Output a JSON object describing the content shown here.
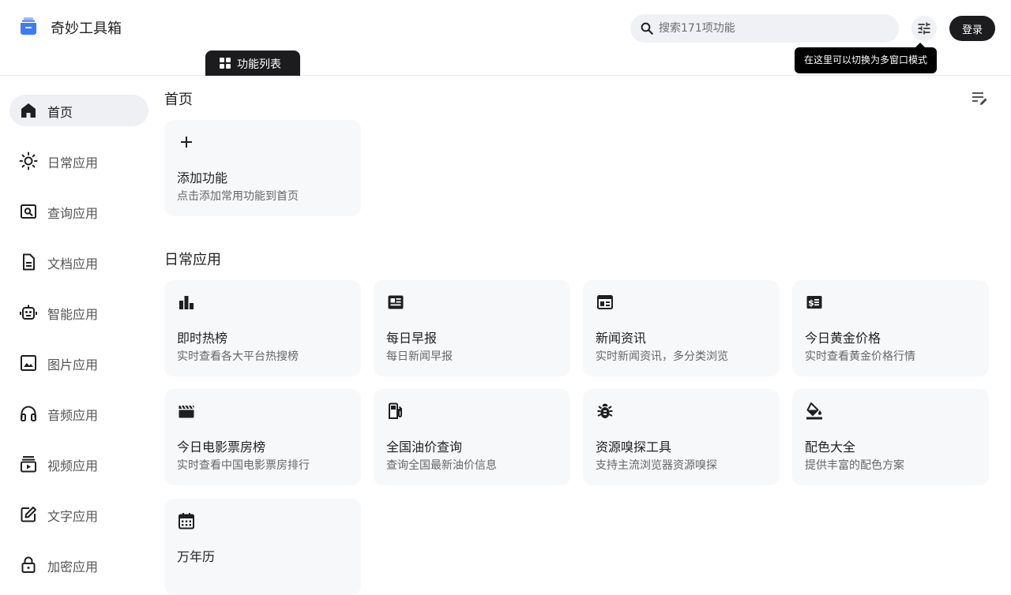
{
  "app": {
    "title": "奇妙工具箱"
  },
  "search": {
    "placeholder": "搜索171项功能"
  },
  "header": {
    "login_label": "登录",
    "tooltip": "在这里可以切换为多窗口模式",
    "tab_label": "功能列表"
  },
  "sidebar": {
    "items": [
      {
        "label": "首页",
        "icon": "home-icon",
        "active": true
      },
      {
        "label": "日常应用",
        "icon": "sun-icon"
      },
      {
        "label": "查询应用",
        "icon": "search-document-icon"
      },
      {
        "label": "文档应用",
        "icon": "document-icon"
      },
      {
        "label": "智能应用",
        "icon": "robot-icon"
      },
      {
        "label": "图片应用",
        "icon": "image-icon"
      },
      {
        "label": "音频应用",
        "icon": "headphones-icon"
      },
      {
        "label": "视频应用",
        "icon": "video-icon"
      },
      {
        "label": "文字应用",
        "icon": "edit-icon"
      },
      {
        "label": "加密应用",
        "icon": "lock-icon"
      }
    ]
  },
  "home": {
    "title": "首页",
    "add_card": {
      "title": "添加功能",
      "desc": "点击添加常用功能到首页",
      "icon": "plus-icon"
    }
  },
  "daily": {
    "title": "日常应用",
    "cards": [
      {
        "title": "即时热榜",
        "desc": "实时查看各大平台热搜榜",
        "icon": "bar-chart-icon"
      },
      {
        "title": "每日早报",
        "desc": "每日新闻早报",
        "icon": "newspaper-icon"
      },
      {
        "title": "新闻资讯",
        "desc": "实时新闻资讯，多分类浏览",
        "icon": "web-news-icon"
      },
      {
        "title": "今日黄金价格",
        "desc": "实时查看黄金价格行情",
        "icon": "money-icon"
      },
      {
        "title": "今日电影票房榜",
        "desc": "实时查看中国电影票房排行",
        "icon": "clapperboard-icon"
      },
      {
        "title": "全国油价查询",
        "desc": "查询全国最新油价信息",
        "icon": "gas-station-icon"
      },
      {
        "title": "资源嗅探工具",
        "desc": "支持主流浏览器资源嗅探",
        "icon": "bug-icon"
      },
      {
        "title": "配色大全",
        "desc": "提供丰富的配色方案",
        "icon": "paint-bucket-icon"
      },
      {
        "title": "万年历",
        "desc": "",
        "icon": "calendar-icon"
      }
    ]
  },
  "colors": {
    "accent_dark": "#1c1c1e",
    "logo_blue": "#3d7cf5",
    "card_bg": "#f7f8fa"
  }
}
